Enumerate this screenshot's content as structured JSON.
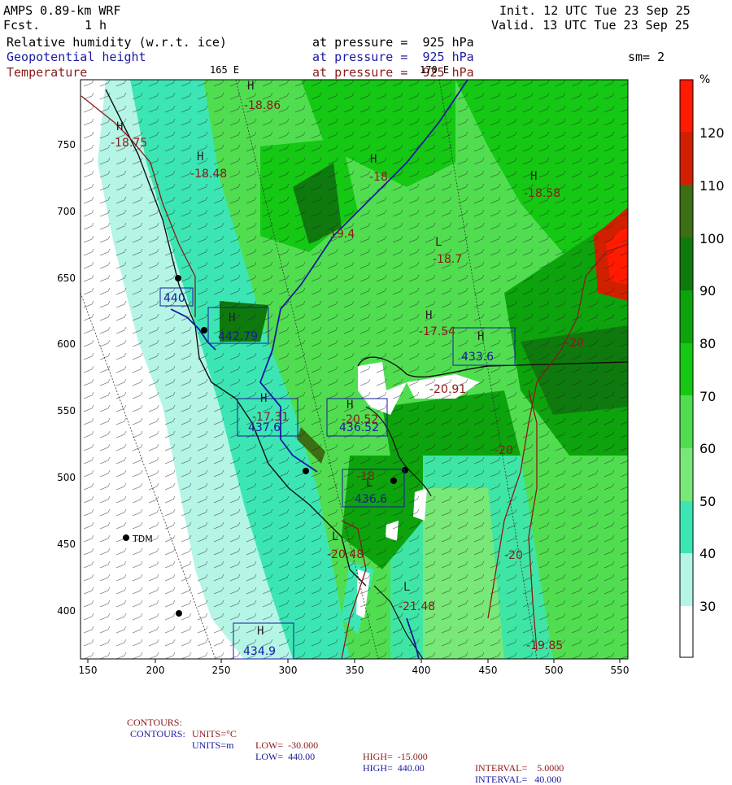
{
  "header": {
    "model": "AMPS 0.89-km WRF",
    "fcst_label": "Fcst.",
    "fcst_value": "1 h",
    "init": "Init. 12 UTC Tue 23 Sep 25",
    "valid": "Valid. 13 UTC Tue 23 Sep 25",
    "fields": [
      {
        "name": "Relative humidity (w.r.t. ice)",
        "level": "at pressure =  925 hPa",
        "color": "#000000"
      },
      {
        "name": "Geopotential height",
        "level": "at pressure =  925 hPa",
        "color": "#1a1aa0"
      },
      {
        "name": "Temperature",
        "level": "at pressure =  925 hPa",
        "color": "#8b1a1a"
      }
    ],
    "smoothing": "sm= 2",
    "lon_165": "165 E",
    "lon_170": "170 E"
  },
  "map": {
    "x_ticks": [
      "150",
      "200",
      "250",
      "300",
      "350",
      "400",
      "450",
      "500",
      "550"
    ],
    "y_ticks": [
      "750",
      "700",
      "650",
      "600",
      "550",
      "500",
      "450",
      "400"
    ],
    "station": "TDM",
    "temp_labels": [
      {
        "text": "-18.86",
        "kind": "temp"
      },
      {
        "text": "-18.75",
        "kind": "temp"
      },
      {
        "text": "-18.48",
        "kind": "temp"
      },
      {
        "text": "-18.58",
        "kind": "temp"
      },
      {
        "text": "-19.4",
        "kind": "temp"
      },
      {
        "text": "-18.7",
        "kind": "temp"
      },
      {
        "text": "-17.54",
        "kind": "temp"
      },
      {
        "text": "-20",
        "kind": "temp"
      },
      {
        "text": "-20.91",
        "kind": "temp"
      },
      {
        "text": "-17.31",
        "kind": "temp"
      },
      {
        "text": "-20.52",
        "kind": "temp"
      },
      {
        "text": "-18",
        "kind": "temp"
      },
      {
        "text": "-20",
        "kind": "temp"
      },
      {
        "text": "-20.48",
        "kind": "temp"
      },
      {
        "text": "-20",
        "kind": "temp"
      },
      {
        "text": "-21.48",
        "kind": "temp"
      },
      {
        "text": "-19.85",
        "kind": "temp"
      },
      {
        "text": "-18",
        "kind": "temp"
      }
    ],
    "height_labels": [
      {
        "text": "440"
      },
      {
        "text": "442.79"
      },
      {
        "text": "433.6"
      },
      {
        "text": "437.6"
      },
      {
        "text": "436.52"
      },
      {
        "text": "436.6"
      },
      {
        "text": "434.9"
      }
    ]
  },
  "colorbar": {
    "unit": "%",
    "levels": [
      "120",
      "110",
      "100",
      "90",
      "80",
      "70",
      "60",
      "50",
      "40",
      "30"
    ],
    "colors": [
      "#ff1a00",
      "#d02000",
      "#3c6e14",
      "#0e7a0e",
      "#0da30d",
      "#14c814",
      "#50de50",
      "#78e878",
      "#3ce6b4",
      "#b4f5e6",
      "#ffffff"
    ]
  },
  "footer": {
    "line1": {
      "contours": "CONTOURS:",
      "units": "UNITS=°C",
      "low": "LOW=  -30.000",
      "high": "HIGH=  -15.000",
      "interval": "INTERVAL=    5.0000",
      "color": "#8b1a1a"
    },
    "line2": {
      "contours": "CONTOURS:",
      "units": "UNITS=m",
      "low": "LOW=  440.00",
      "high": "HIGH=  440.00",
      "interval": "INTERVAL=   40.000",
      "color": "#1a1aa0"
    }
  }
}
